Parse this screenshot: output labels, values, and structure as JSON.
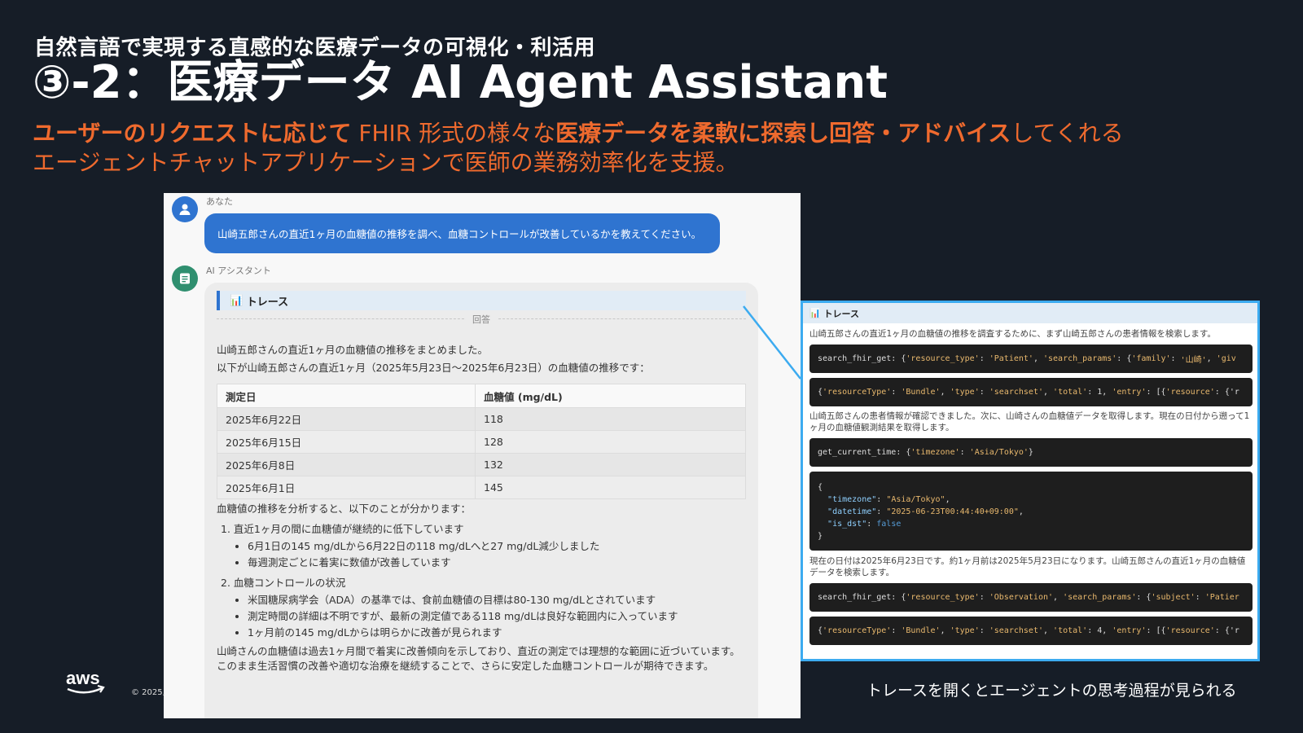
{
  "slide": {
    "subtitle": "自然言語で実現する直感的な医療データの可視化・利活用",
    "title": "③-2：医療データ AI Agent Assistant",
    "lead": {
      "p1": "ユーザーのリクエストに応じて",
      "p2": " FHIR 形式の様々な",
      "p3": "医療データを柔軟に探索し回答・アドバイス",
      "p4": "してくれる",
      "line2": "エージェントチャットアプリケーションで医師の業務効率化を支援。"
    },
    "caption": "トレースを開くとエージェントの思考過程が見られる",
    "copyright": "© 2025,",
    "logo": "aws",
    "accent_color": "#ef6a2e"
  },
  "chat": {
    "user_label": "あなた",
    "user_message": "山崎五郎さんの直近1ヶ月の血糖値の推移を調べ、血糖コントロールが改善しているかを教えてください。",
    "ai_label": "AI アシスタント",
    "trace_icon": "📊",
    "trace_label": "トレース",
    "answer_divider": "回答",
    "intro1": "山崎五郎さんの直近1ヶ月の血糖値の推移をまとめました。",
    "intro2": "以下が山崎五郎さんの直近1ヶ月（2025年5月23日〜2025年6月23日）の血糖値の推移です：",
    "table": {
      "headers": [
        "測定日",
        "血糖値 (mg/dL)"
      ],
      "rows": [
        [
          "2025年6月22日",
          "118"
        ],
        [
          "2025年6月15日",
          "128"
        ],
        [
          "2025年6月8日",
          "132"
        ],
        [
          "2025年6月1日",
          "145"
        ]
      ]
    },
    "analysis_intro": "血糖値の推移を分析すると、以下のことが分かります：",
    "point1": {
      "title": "1. 直近1ヶ月の間に血糖値が継続的に低下しています",
      "bullets": [
        "6月1日の145 mg/dLから6月22日の118 mg/dLへと27 mg/dL減少しました",
        "毎週測定ごとに着実に数値が改善しています"
      ]
    },
    "point2": {
      "title": "2. 血糖コントロールの状況",
      "bullets": [
        "米国糖尿病学会（ADA）の基準では、食前血糖値の目標は80-130 mg/dLとされています",
        "測定時間の詳細は不明ですが、最新の測定値である118 mg/dLは良好な範囲内に入っています",
        "1ヶ月前の145 mg/dLからは明らかに改善が見られます"
      ]
    },
    "closing": "山崎さんの血糖値は過去1ヶ月間で着実に改善傾向を示しており、直近の測定では理想的な範囲に近づいています。このまま生活習慣の改善や適切な治療を継続することで、さらに安定した血糖コントロールが期待できます。"
  },
  "trace": {
    "icon": "📊",
    "title": "トレース",
    "step1": "山崎五郎さんの直近1ヶ月の血糖値の推移を調査するために、まず山崎五郎さんの患者情報を検索します。",
    "call1": {
      "fn": "search_fhir_get: ",
      "a": "{",
      "b": "'resource_type'",
      "c": ": ",
      "d": "'Patient'",
      "e": ", ",
      "f": "'search_params'",
      "g": ": {",
      "h": "'family'",
      "i": ": ",
      "j": "'山崎'",
      "k": ", ",
      "l": "'giv"
    },
    "result1": {
      "a": "{",
      "b": "'resourceType'",
      "c": ": ",
      "d": "'Bundle'",
      "e": ", ",
      "f": "'type'",
      "g": ": ",
      "h": "'searchset'",
      "i": ", ",
      "j": "'total'",
      "k": ": 1, ",
      "l": "'entry'",
      "m": ": [{",
      "n": "'resource'",
      "o": ": {'r"
    },
    "step2": "山崎五郎さんの患者情報が確認できました。次に、山崎さんの血糖値データを取得します。現在の日付から遡って1ヶ月の血糖値観測結果を取得します。",
    "call2": {
      "fn": "get_current_time: ",
      "a": "{",
      "b": "'timezone'",
      "c": ": ",
      "d": "'Asia/Tokyo'",
      "e": "}"
    },
    "result2": {
      "open": "{",
      "k1": "\"timezone\"",
      "v1": "\"Asia/Tokyo\"",
      "k2": "\"datetime\"",
      "v2": "\"2025-06-23T00:44:40+09:00\"",
      "k3": "\"is_dst\"",
      "v3": "false",
      "close": "}"
    },
    "step3": "現在の日付は2025年6月23日です。約1ヶ月前は2025年5月23日になります。山崎五郎さんの直近1ヶ月の血糖値データを検索します。",
    "call3": {
      "fn": "search_fhir_get: ",
      "a": "{",
      "b": "'resource_type'",
      "c": ": ",
      "d": "'Observation'",
      "e": ", ",
      "f": "'search_params'",
      "g": ": {",
      "h": "'subject'",
      "i": ": ",
      "j": "'Patier"
    },
    "result3": {
      "a": "{",
      "b": "'resourceType'",
      "c": ": ",
      "d": "'Bundle'",
      "e": ", ",
      "f": "'type'",
      "g": ": ",
      "h": "'searchset'",
      "i": ", ",
      "j": "'total'",
      "k": ": 4, ",
      "l": "'entry'",
      "m": ": [{",
      "n": "'resource'",
      "o": ": {'r"
    }
  }
}
